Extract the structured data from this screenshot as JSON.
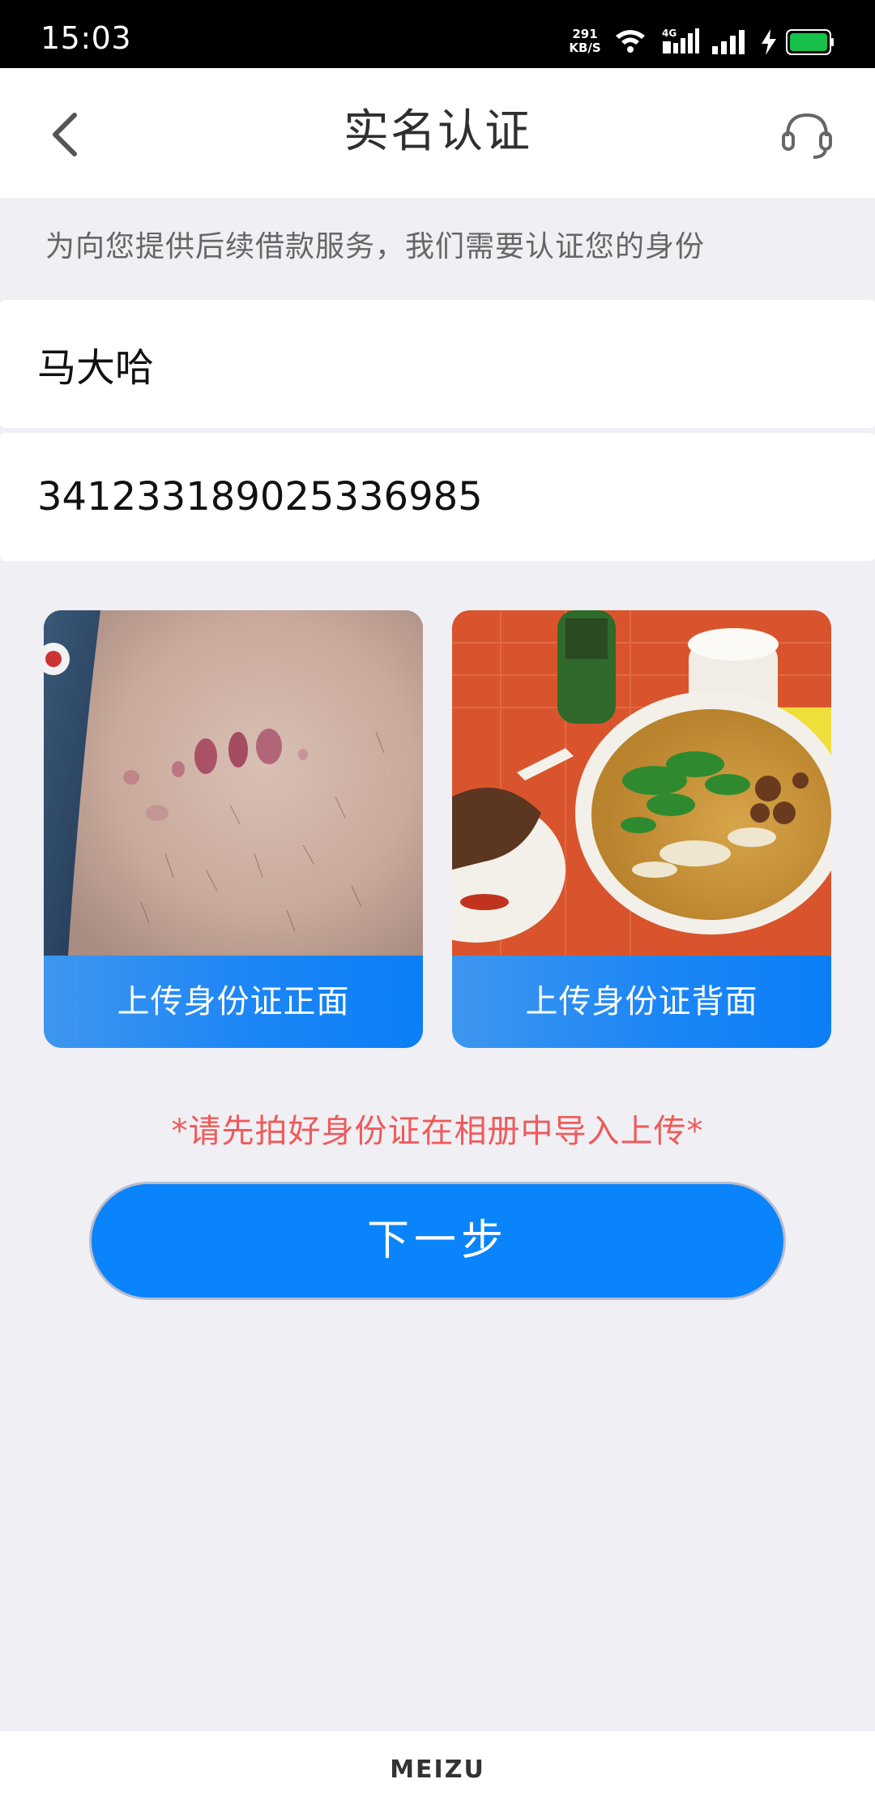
{
  "status_bar": {
    "time": "15:03",
    "net_speed_value": "291",
    "net_speed_unit": "KB/S",
    "network_type": "4G",
    "icons": [
      "wifi-icon",
      "cell-4g-icon",
      "cell-icon",
      "charging-icon",
      "battery-icon"
    ],
    "battery_color": "#16c04a"
  },
  "header": {
    "title": "实名认证",
    "back_icon": "chevron-left-icon",
    "support_icon": "headset-icon"
  },
  "hint": "为向您提供后续借款服务，我们需要认证您的身份",
  "form": {
    "name_value": "马大哈",
    "id_number_value": "341233189025336985"
  },
  "uploads": {
    "front_label": "上传身份证正面",
    "back_label": "上传身份证背面"
  },
  "notice": "*请先拍好身份证在相册中导入上传*",
  "next_label": "下一步",
  "footer": {
    "brand": "MEIZU"
  },
  "colors": {
    "accent": "#0a84fb",
    "notice": "#ef5a5a",
    "background": "#efeff4"
  }
}
